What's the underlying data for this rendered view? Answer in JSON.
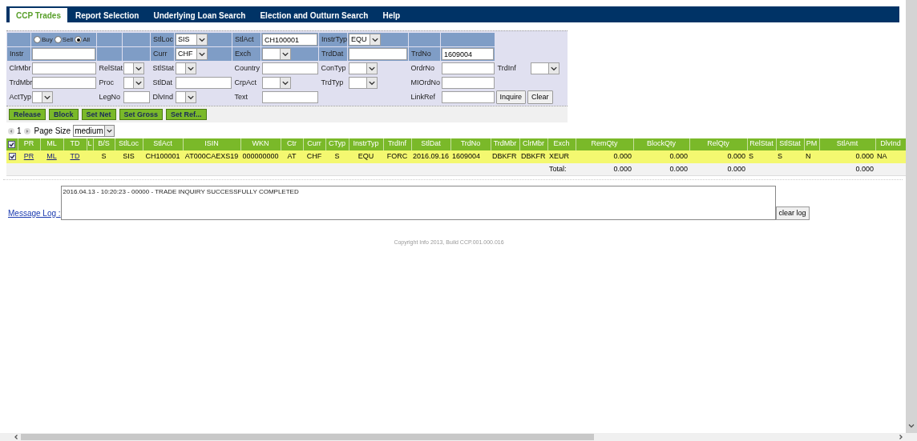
{
  "nav": {
    "tabs": [
      {
        "label": "CCP Trades",
        "selected": true
      },
      {
        "label": "Report Selection",
        "selected": false
      },
      {
        "label": "Underlying Loan Search",
        "selected": false
      },
      {
        "label": "Election and Outturn Search",
        "selected": false
      },
      {
        "label": "Help",
        "selected": false
      }
    ]
  },
  "filter": {
    "rows": [
      {
        "header": true,
        "cells": [
          {
            "kind": "blank"
          },
          {
            "kind": "radios",
            "options": [
              {
                "label": "Buy",
                "selected": false
              },
              {
                "label": "Sell",
                "selected": false
              },
              {
                "label": "All",
                "selected": true
              }
            ]
          },
          {
            "kind": "blank"
          },
          {
            "kind": "blank"
          },
          {
            "kind": "label",
            "text": "StlLoc"
          },
          {
            "kind": "select",
            "value": "SIS"
          },
          {
            "kind": "label",
            "text": "StlAct"
          },
          {
            "kind": "input",
            "value": "CH100001"
          },
          {
            "kind": "label",
            "text": "InstrTyp"
          },
          {
            "kind": "select",
            "value": "EQU"
          },
          {
            "kind": "blank"
          },
          {
            "kind": "blank"
          }
        ]
      },
      {
        "header": true,
        "cells": [
          {
            "kind": "label",
            "text": "Instr"
          },
          {
            "kind": "input"
          },
          {
            "kind": "blank"
          },
          {
            "kind": "blank"
          },
          {
            "kind": "label",
            "text": "Curr"
          },
          {
            "kind": "select",
            "value": "CHF"
          },
          {
            "kind": "label",
            "text": "Exch"
          },
          {
            "kind": "select"
          },
          {
            "kind": "label",
            "text": "TrdDat"
          },
          {
            "kind": "input"
          },
          {
            "kind": "label",
            "text": "TrdNo"
          },
          {
            "kind": "input",
            "value": "1609004"
          }
        ]
      },
      {
        "header": false,
        "cells": [
          {
            "kind": "label",
            "text": "ClrMbr"
          },
          {
            "kind": "input"
          },
          {
            "kind": "label",
            "text": "RelStat"
          },
          {
            "kind": "select"
          },
          {
            "kind": "label",
            "text": "StlStat"
          },
          {
            "kind": "select"
          },
          {
            "kind": "label",
            "text": "Country"
          },
          {
            "kind": "input"
          },
          {
            "kind": "label",
            "text": "ConTyp"
          },
          {
            "kind": "select"
          },
          {
            "kind": "label",
            "text": "OrdrNo"
          },
          {
            "kind": "input"
          },
          {
            "kind": "label",
            "text": "TrdInf"
          },
          {
            "kind": "select"
          }
        ]
      },
      {
        "header": false,
        "cells": [
          {
            "kind": "label",
            "text": "TrdMbr"
          },
          {
            "kind": "input"
          },
          {
            "kind": "label",
            "text": "Proc"
          },
          {
            "kind": "select"
          },
          {
            "kind": "label",
            "text": "StlDat"
          },
          {
            "kind": "input"
          },
          {
            "kind": "label",
            "text": "CrpAct"
          },
          {
            "kind": "select"
          },
          {
            "kind": "label",
            "text": "TrdTyp"
          },
          {
            "kind": "select"
          },
          {
            "kind": "label",
            "text": "MIOrdNo"
          },
          {
            "kind": "input"
          }
        ]
      },
      {
        "header": false,
        "cells": [
          {
            "kind": "label",
            "text": "ActTyp"
          },
          {
            "kind": "select"
          },
          {
            "kind": "label",
            "text": "LegNo"
          },
          {
            "kind": "input"
          },
          {
            "kind": "label",
            "text": "DlvInd"
          },
          {
            "kind": "select"
          },
          {
            "kind": "label",
            "text": "Text"
          },
          {
            "kind": "input"
          },
          {
            "kind": "blank"
          },
          {
            "kind": "blank"
          },
          {
            "kind": "label",
            "text": "LinkRef"
          },
          {
            "kind": "input"
          },
          {
            "kind": "buttons",
            "buttons": [
              "Inquire",
              "Clear"
            ]
          }
        ]
      }
    ]
  },
  "actions": [
    "Release",
    "Block",
    "Set Net",
    "Set Gross",
    "Set Ref..."
  ],
  "pager": {
    "page": "1",
    "page_size_label": "Page Size",
    "page_size": "medium"
  },
  "table": {
    "all_checked": true,
    "columns": [
      {
        "label": "PR",
        "link": true
      },
      {
        "label": "ML",
        "link": true
      },
      {
        "label": "TD",
        "link": true
      },
      {
        "label": "L"
      },
      {
        "label": "B/S"
      },
      {
        "label": "StlLoc"
      },
      {
        "label": "StlAct"
      },
      {
        "label": "ISIN"
      },
      {
        "label": "WKN"
      },
      {
        "label": "Ctr"
      },
      {
        "label": "Curr"
      },
      {
        "label": "CTyp"
      },
      {
        "label": "InstrTyp"
      },
      {
        "label": "TrdInf"
      },
      {
        "label": "StlDat"
      },
      {
        "label": "TrdNo"
      },
      {
        "label": "TrdMbr"
      },
      {
        "label": "ClrMbr"
      },
      {
        "label": "Exch",
        "total": "Total:"
      },
      {
        "label": "RemQty",
        "total": "0.000"
      },
      {
        "label": "BlockQty",
        "total": "0.000"
      },
      {
        "label": "RelQty",
        "total": "0.000"
      },
      {
        "label": "RelStat"
      },
      {
        "label": "StlStat"
      },
      {
        "label": "PM"
      },
      {
        "label": "StlAmt",
        "total": "0.000"
      },
      {
        "label": "DlvInd"
      }
    ],
    "rows": [
      {
        "checked": true,
        "cells": [
          "PR",
          "ML",
          "TD",
          "",
          "S",
          "SIS",
          "CH100001",
          "AT000CAEXS19",
          "000000000",
          "AT",
          "CHF",
          "S",
          "EQU",
          "FORC",
          "2016.09.16",
          "1609004",
          "DBKFR",
          "DBKFR",
          "XEUR",
          "0.000",
          "0.000",
          "0.000",
          "S",
          "S",
          "N",
          "0.000",
          "NA"
        ]
      }
    ]
  },
  "message_log": {
    "label": "Message Log :",
    "text": "2016.04.13 - 10:20:23 - 00000 - TRADE INQUIRY SUCCESSFULLY COMPLETED",
    "button": "clear log"
  },
  "footer": "Copyright Info 2013, Build CCP.001.000.016"
}
